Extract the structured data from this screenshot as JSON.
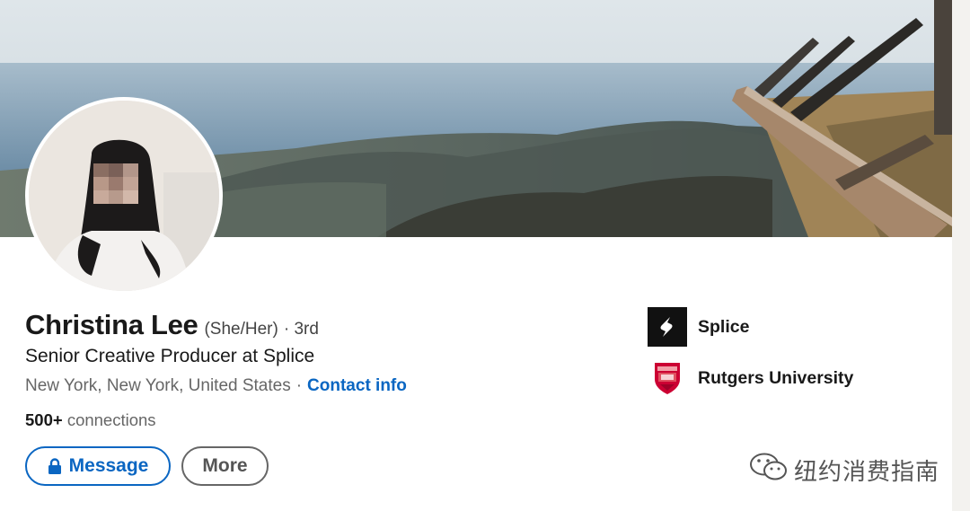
{
  "profile": {
    "name": "Christina Lee",
    "pronouns": "(She/Her)",
    "degree": "· 3rd",
    "headline": "Senior Creative Producer at Splice",
    "location": "New York, New York, United States",
    "location_separator": "·",
    "contact_link": "Contact info",
    "connections_count": "500+",
    "connections_label": "connections"
  },
  "actions": {
    "message_label": "Message",
    "more_label": "More"
  },
  "side": {
    "experience": {
      "label": "Splice",
      "logo": "splice-logo"
    },
    "education": {
      "label": "Rutgers University",
      "logo": "rutgers-shield-logo"
    }
  },
  "watermark": {
    "text": "纽约消费指南",
    "icon": "wechat-icon"
  },
  "colors": {
    "link_blue": "#0a66c2",
    "text_primary": "#191919",
    "text_secondary": "#666666",
    "rutgers_red": "#cc0033",
    "splice_black": "#111111"
  }
}
